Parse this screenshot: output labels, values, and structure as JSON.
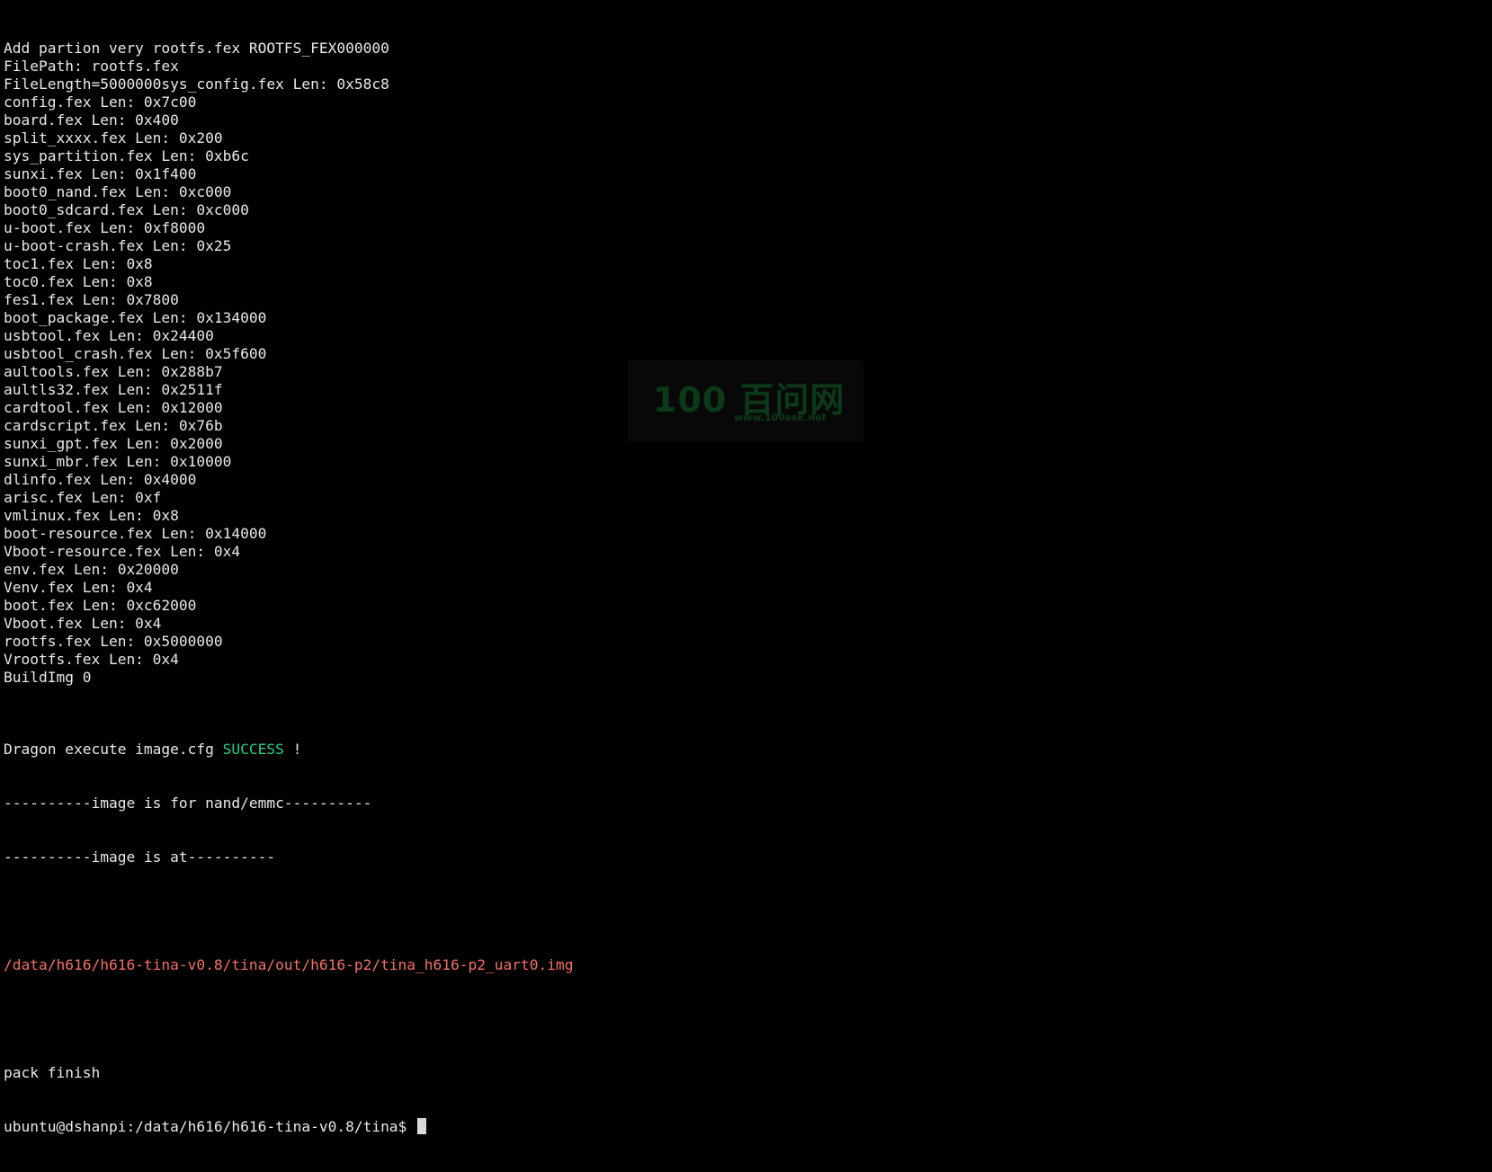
{
  "terminal": {
    "lines": [
      "Add partion very rootfs.fex ROOTFS_FEX000000",
      "FilePath: rootfs.fex",
      "FileLength=5000000sys_config.fex Len: 0x58c8",
      "config.fex Len: 0x7c00",
      "board.fex Len: 0x400",
      "split_xxxx.fex Len: 0x200",
      "sys_partition.fex Len: 0xb6c",
      "sunxi.fex Len: 0x1f400",
      "boot0_nand.fex Len: 0xc000",
      "boot0_sdcard.fex Len: 0xc000",
      "u-boot.fex Len: 0xf8000",
      "u-boot-crash.fex Len: 0x25",
      "toc1.fex Len: 0x8",
      "toc0.fex Len: 0x8",
      "fes1.fex Len: 0x7800",
      "boot_package.fex Len: 0x134000",
      "usbtool.fex Len: 0x24400",
      "usbtool_crash.fex Len: 0x5f600",
      "aultools.fex Len: 0x288b7",
      "aultls32.fex Len: 0x2511f",
      "cardtool.fex Len: 0x12000",
      "cardscript.fex Len: 0x76b",
      "sunxi_gpt.fex Len: 0x2000",
      "sunxi_mbr.fex Len: 0x10000",
      "dlinfo.fex Len: 0x4000",
      "arisc.fex Len: 0xf",
      "vmlinux.fex Len: 0x8",
      "boot-resource.fex Len: 0x14000",
      "Vboot-resource.fex Len: 0x4",
      "env.fex Len: 0x20000",
      "Venv.fex Len: 0x4",
      "boot.fex Len: 0xc62000",
      "Vboot.fex Len: 0x4",
      "rootfs.fex Len: 0x5000000",
      "Vrootfs.fex Len: 0x4",
      "BuildImg 0"
    ],
    "dragon_prefix": "Dragon execute image.cfg ",
    "dragon_status": "SUCCESS",
    "dragon_suffix": " !",
    "image_for": "----------image is for nand/emmc----------",
    "image_at": "----------image is at----------",
    "image_path": "/data/h616/h616-tina-v0.8/tina/out/h616-p2/tina_h616-p2_uart0.img",
    "pack_finish": "pack finish",
    "prompt": "ubuntu@dshanpi:/data/h616/h616-tina-v0.8/tina$ "
  },
  "watermark": {
    "logo": "100 百问网",
    "url": "www.100ask.net"
  },
  "colors": {
    "background": "#000000",
    "text": "#e9e9e9",
    "success": "#23d18b",
    "path": "#f47067"
  }
}
